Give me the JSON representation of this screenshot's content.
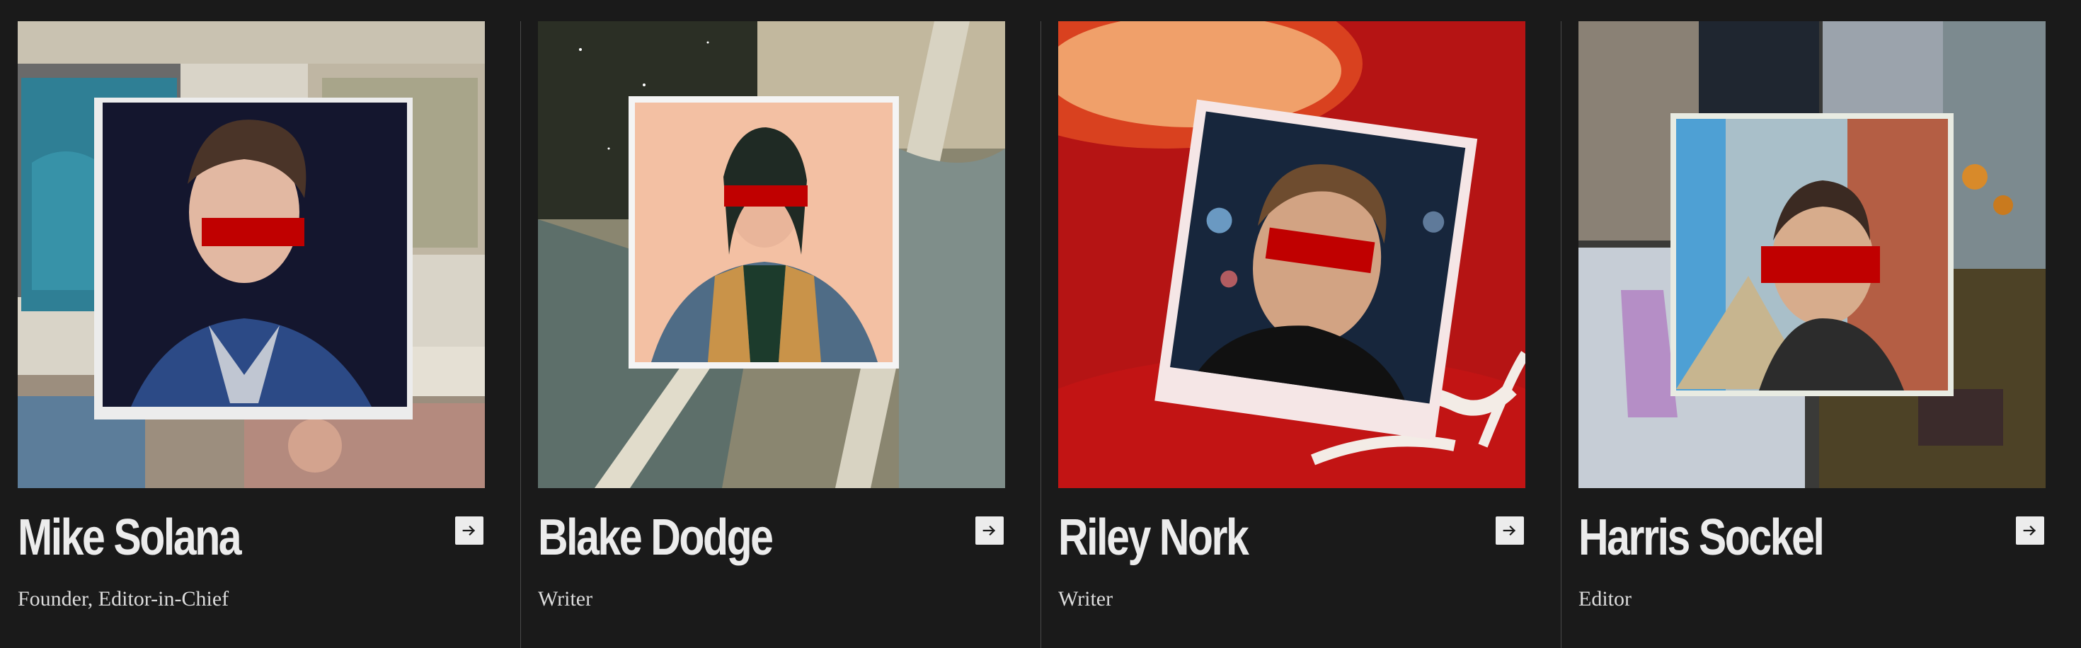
{
  "team": [
    {
      "name": "Mike Solana",
      "role": "Founder, Editor-in-Chief",
      "arrow_icon": "arrow-right-icon"
    },
    {
      "name": "Blake Dodge",
      "role": "Writer",
      "arrow_icon": "arrow-right-icon"
    },
    {
      "name": "Riley Nork",
      "role": "Writer",
      "arrow_icon": "arrow-right-icon"
    },
    {
      "name": "Harris Sockel",
      "role": "Editor",
      "arrow_icon": "arrow-right-icon"
    }
  ],
  "colors": {
    "background": "#1a1a1a",
    "text": "#ececec",
    "censor_bar": "#c00000",
    "divider": "#4a4a4a"
  }
}
